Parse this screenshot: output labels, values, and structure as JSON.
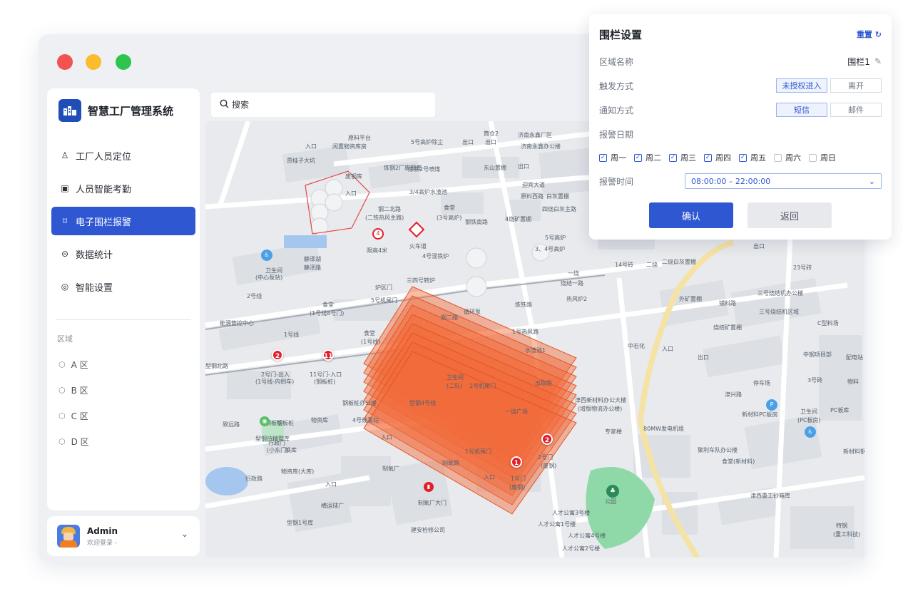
{
  "window": {
    "controls": [
      "close",
      "minimize",
      "maximize"
    ]
  },
  "app": {
    "title": "智慧工厂管理系统",
    "logo_icon": "factory-icon"
  },
  "sidebar": {
    "items": [
      {
        "label": "工厂人员定位",
        "icon": "person-location-icon",
        "active": false
      },
      {
        "label": "人员智能考勤",
        "icon": "calendar-icon",
        "active": false
      },
      {
        "label": "电子围栏报警",
        "icon": "fence-icon",
        "active": true
      },
      {
        "label": "数据统计",
        "icon": "stats-icon",
        "active": false
      },
      {
        "label": "智能设置",
        "icon": "settings-icon",
        "active": false
      }
    ],
    "region_title": "区域",
    "regions": [
      {
        "label": "A 区",
        "icon": "cube-icon"
      },
      {
        "label": "B 区",
        "icon": "cube-icon"
      },
      {
        "label": "C 区",
        "icon": "cube-icon"
      },
      {
        "label": "D 区",
        "icon": "cube-icon"
      }
    ]
  },
  "user": {
    "name": "Admin",
    "status": "欢迎登录 -"
  },
  "search": {
    "placeholder": "搜索"
  },
  "map": {
    "labels": [
      "原料平台",
      "入口",
      "闲置物资库房",
      "贾桂子大坑",
      "炼钢2厂废钢库",
      "炼铁2号喷煤",
      "东山置棚",
      "出口",
      "济南永鑫厂区",
      "济南永鑫办公楼",
      "5号高炉除尘",
      "筒仓2",
      "出口",
      "出口",
      "废钢库",
      "入口",
      "3/4高炉水渣池",
      "原料西路",
      "迎宾大道",
      "白灰置棚",
      "四烧白灰主路",
      "钢二北路",
      "(二铁热风主路)",
      "食堂",
      "(3号高炉)",
      "钢铁南路",
      "4烧矿置棚",
      "静泽湖",
      "静泽路",
      "卫生间",
      "(中心泵站)",
      "限高4米",
      "火车道",
      "4号混铁炉",
      "5号高炉",
      "3、4号高炉",
      "一烧",
      "烧结一路",
      "热风炉2",
      "2号线",
      "食堂",
      "(1号线8号门)",
      "三四号转炉",
      "炉区门",
      "5号机尾门",
      "循环泵",
      "炼铁路",
      "14号砖",
      "二烧",
      "二烧白灰置棚",
      "出口",
      "23号砖",
      "能源管控中心",
      "1号线",
      "食堂",
      "(1号线)",
      "钢二路",
      "1号热风路",
      "外矿置棚",
      "铺料路",
      "三号烧结机办公楼",
      "三号烧结机区域",
      "C型料场",
      "烧结矿置棚",
      "型钢北路",
      "2号门-出入",
      "(1号线-内倒车)",
      "11号门-入口",
      "(钢板桩)",
      "钢板桩",
      "中石化",
      "入口",
      "出口",
      "水渣池1",
      "中钢项目部",
      "配电站",
      "卫生间",
      "(二轧)",
      "2号机尾门",
      "出取路",
      "停车场",
      "3号砖",
      "物料",
      "津西新材料办公大楼",
      "(增版物流办公楼)",
      "津兴路",
      "新材料PC板房",
      "卫生间",
      "(PC板房)",
      "PC板库",
      "钢板桩办公楼",
      "型钢4号线",
      "一烧广场",
      "专家楼",
      "80MW发电机组",
      "聚利车队办公楼",
      "食堂(新材料)",
      "新材料钢",
      "致远路",
      "钢板桩",
      "物资库",
      "4号线泵站",
      "行政门",
      "(小东门)",
      "型钢待精整库",
      "铁库",
      "入口",
      "1号机尾门",
      "2号门",
      "(废钢)",
      "行政路",
      "物资库(大库)",
      "入口",
      "制氧厂",
      "制氧路",
      "入口",
      "1号门",
      "(废钢)",
      "公园",
      "津西重工砂箱库",
      "横运球厂",
      "型钢1号库",
      "制氧厂大门",
      "建安检修公司",
      "人才公寓3号楼",
      "人才公寓1号楼",
      "人才公寓4号楼",
      "人才公寓2号楼",
      "特钢",
      "(重工科技)"
    ],
    "pins": [
      "2",
      "11",
      "2",
      "1"
    ],
    "layers": 8
  },
  "panel": {
    "title": "围栏设置",
    "reset_label": "重置",
    "reset_icon": "refresh-icon",
    "region_name_label": "区域名称",
    "region_name_value": "围栏1",
    "edit_icon": "pencil-icon",
    "trigger_label": "触发方式",
    "trigger_options": [
      {
        "label": "未授权进入",
        "selected": true
      },
      {
        "label": "离开",
        "selected": false
      }
    ],
    "notify_label": "通知方式",
    "notify_options": [
      {
        "label": "短信",
        "selected": true
      },
      {
        "label": "邮件",
        "selected": false
      }
    ],
    "date_label": "报警日期",
    "days": [
      {
        "label": "周一",
        "checked": true
      },
      {
        "label": "周二",
        "checked": true
      },
      {
        "label": "周三",
        "checked": true
      },
      {
        "label": "周四",
        "checked": true
      },
      {
        "label": "周五",
        "checked": true
      },
      {
        "label": "周六",
        "checked": false
      },
      {
        "label": "周日",
        "checked": false
      }
    ],
    "time_label": "报警时间",
    "time_value": "08:00:00 – 22:00:00",
    "confirm_label": "确认",
    "back_label": "返回"
  },
  "colors": {
    "accent": "#2f57d1",
    "fence": "#f26a3a",
    "pin": "#e21f2a"
  }
}
